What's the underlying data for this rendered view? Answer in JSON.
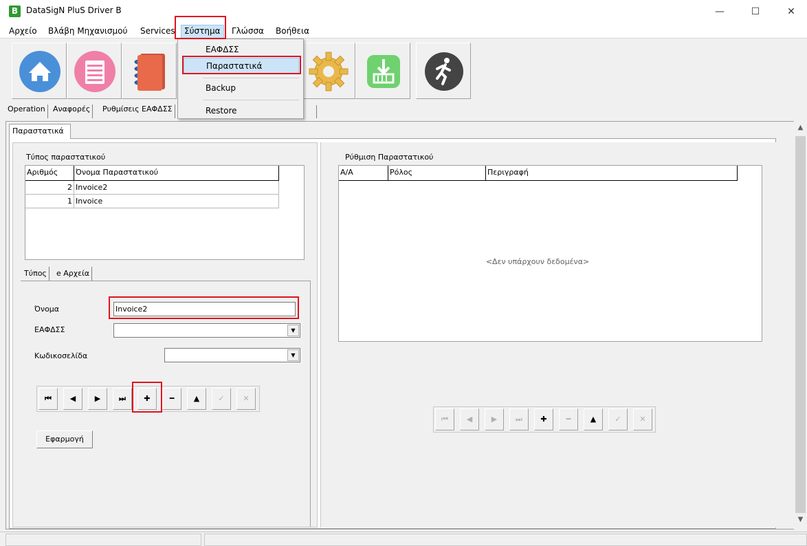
{
  "window": {
    "logo_letter": "B",
    "title": "DataSigN PluS Driver B",
    "minimize": "—",
    "maximize": "☐",
    "close": "✕"
  },
  "menu": {
    "file": "Αρχείο",
    "fault": "Βλάβη Μηχανισμού",
    "services": "Services",
    "system": "Σύστημα",
    "language": "Γλώσσα",
    "help": "Βοήθεια"
  },
  "system_dropdown": {
    "items": [
      "ΕΑΦΔΣΣ",
      "Παραστατικά",
      "Backup",
      "Restore"
    ],
    "highlighted": "Παραστατικά"
  },
  "toolbar": {
    "icons": [
      "home-icon",
      "notepad-icon",
      "notebook-icon",
      "settings-icon",
      "download-icon",
      "running-man-icon"
    ],
    "colors": {
      "home": "#4a90d9",
      "notepad": "#f07fa8",
      "notebook": "#e86a4a",
      "settings": "#e8b84a",
      "download": "#6fd16f",
      "exit": "#444444"
    }
  },
  "main_tabs": [
    "Operation",
    "Αναφορές",
    "Ρυθμίσεις ΕΑΦΔΣΣ"
  ],
  "inner_tab": "Παραστατικά",
  "type_section": {
    "label": "Τύπος παραστατικού",
    "columns": [
      "Αριθμός",
      "Όνομα Παραστατικού"
    ],
    "rows": [
      {
        "number": "2",
        "name": "Invoice2"
      },
      {
        "number": "1",
        "name": "Invoice"
      }
    ]
  },
  "sub_tabs": [
    "Τύπος",
    "e Αρχεία"
  ],
  "form": {
    "name_label": "Όνομα",
    "name_value": "Invoice2",
    "eafdss_label": "ΕΑΦΔΣΣ",
    "eafdss_value": "",
    "codepage_label": "Κωδικοσελίδα",
    "codepage_value": "",
    "apply_label": "Εφαρμογή"
  },
  "navigator_left": [
    "⏮",
    "◀",
    "▶",
    "⏭",
    "✚",
    "━",
    "▲",
    "✓",
    "✕"
  ],
  "navigator_right": [
    "⏮",
    "◀",
    "▶",
    "⏭",
    "✚",
    "━",
    "▲",
    "✓",
    "✕"
  ],
  "config_section": {
    "label": "Ρύθμιση Παραστατικού",
    "columns": [
      "Α/Α",
      "Ρόλος",
      "Περιγραφή"
    ],
    "empty_text": "<Δεν υπάρχουν δεδομένα>"
  },
  "accent": {
    "highlight": "#e0141e",
    "selection": "#cce4f7"
  }
}
